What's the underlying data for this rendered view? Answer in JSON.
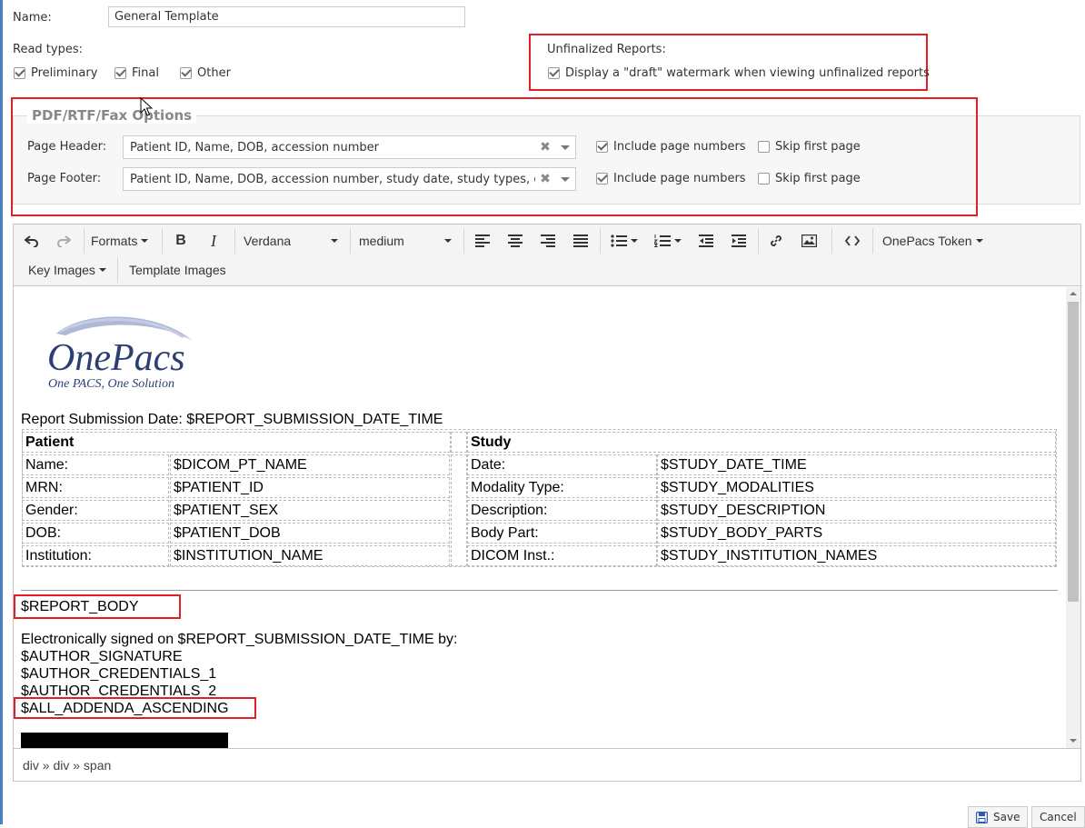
{
  "form": {
    "name_label": "Name:",
    "name_value": "General Template",
    "read_types_label": "Read types:",
    "read_types": [
      {
        "label": "Preliminary",
        "checked": true
      },
      {
        "label": "Final",
        "checked": true
      },
      {
        "label": "Other",
        "checked": true
      }
    ],
    "unfinalized_label": "Unfinalized Reports:",
    "watermark_label": "Display a \"draft\" watermark when viewing unfinalized reports",
    "watermark_checked": true
  },
  "pdf_options": {
    "legend": "PDF/RTF/Fax Options",
    "header_label": "Page Header:",
    "header_value": "Patient ID, Name, DOB, accession number",
    "footer_label": "Page Footer:",
    "footer_value": "Patient ID, Name, DOB, accession number, study date, study types, descr",
    "include_page_numbers": "Include page numbers",
    "skip_first_page": "Skip first page",
    "header_include_checked": true,
    "header_skip_checked": false,
    "footer_include_checked": true,
    "footer_skip_checked": false
  },
  "toolbar": {
    "formats": "Formats",
    "bold": "B",
    "italic": "I",
    "font_family": "Verdana",
    "font_size": "medium",
    "token": "OnePacs Token",
    "key_images": "Key Images",
    "template_images": "Template Images"
  },
  "logo": {
    "brand": "OnePacs",
    "tagline": "One PACS, One Solution"
  },
  "document": {
    "submission_line": "Report Submission Date: $REPORT_SUBMISSION_DATE_TIME",
    "patient_header": "Patient",
    "study_header": "Study",
    "patient_rows": [
      {
        "label": "Name:",
        "value": "$DICOM_PT_NAME"
      },
      {
        "label": "MRN:",
        "value": "$PATIENT_ID"
      },
      {
        "label": "Gender:",
        "value": "$PATIENT_SEX"
      },
      {
        "label": "DOB:",
        "value": "$PATIENT_DOB"
      },
      {
        "label": "Institution:",
        "value": "$INSTITUTION_NAME"
      }
    ],
    "study_rows": [
      {
        "label": "Date:",
        "value": "$STUDY_DATE_TIME"
      },
      {
        "label": "Modality Type:",
        "value": "$STUDY_MODALITIES"
      },
      {
        "label": "Description:",
        "value": "$STUDY_DESCRIPTION"
      },
      {
        "label": "Body Part:",
        "value": "$STUDY_BODY_PARTS"
      },
      {
        "label": "DICOM Inst.:",
        "value": "$STUDY_INSTITUTION_NAMES"
      }
    ],
    "report_body": "$REPORT_BODY",
    "signed_line": "Electronically signed on $REPORT_SUBMISSION_DATE_TIME by:",
    "author_signature": "$AUTHOR_SIGNATURE",
    "author_credentials_1": "$AUTHOR_CREDENTIALS_1",
    "author_credentials_2": "$AUTHOR_CREDENTIALS_2",
    "all_addenda": "$ALL_ADDENDA_ASCENDING"
  },
  "statusbar": {
    "path": "div » div » span"
  },
  "actions": {
    "save": "Save",
    "cancel": "Cancel"
  },
  "colors": {
    "highlight_border": "#e21f26",
    "logo_blue": "#2b3f73"
  }
}
